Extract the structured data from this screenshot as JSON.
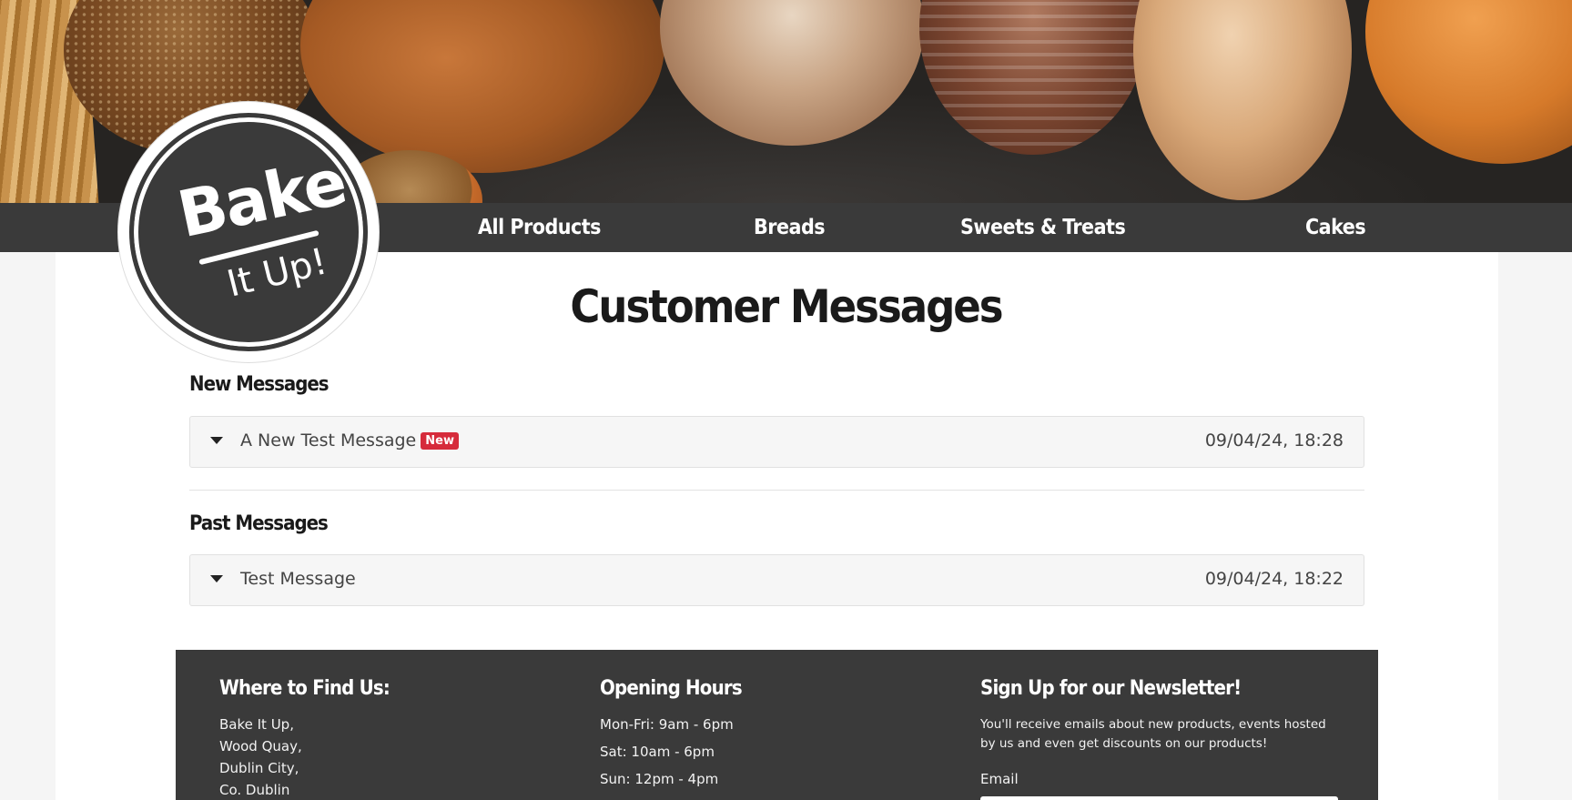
{
  "brand": {
    "logo_line1": "Bake",
    "logo_line2": "It Up!"
  },
  "nav": {
    "items": [
      {
        "label": "All Products"
      },
      {
        "label": "Breads"
      },
      {
        "label": "Sweets & Treats"
      },
      {
        "label": "Cakes"
      }
    ]
  },
  "page": {
    "title": "Customer Messages"
  },
  "new_messages": {
    "heading": "New Messages",
    "items": [
      {
        "subject": "A New Test Message",
        "badge": "New",
        "timestamp": "09/04/24, 18:28"
      }
    ]
  },
  "past_messages": {
    "heading": "Past Messages",
    "items": [
      {
        "subject": "Test Message",
        "timestamp": "09/04/24, 18:22"
      }
    ]
  },
  "footer": {
    "location": {
      "heading": "Where to Find Us:",
      "lines": [
        "Bake It Up,",
        "Wood Quay,",
        "Dublin City,",
        "Co. Dublin"
      ]
    },
    "hours": {
      "heading": "Opening Hours",
      "lines": [
        "Mon-Fri: 9am - 6pm",
        "Sat: 10am - 6pm",
        "Sun: 12pm - 4pm"
      ]
    },
    "newsletter": {
      "heading": "Sign Up for our Newsletter!",
      "text": "You'll receive emails about new products, events hosted by us and even get discounts on our products!",
      "email_label": "Email"
    }
  }
}
